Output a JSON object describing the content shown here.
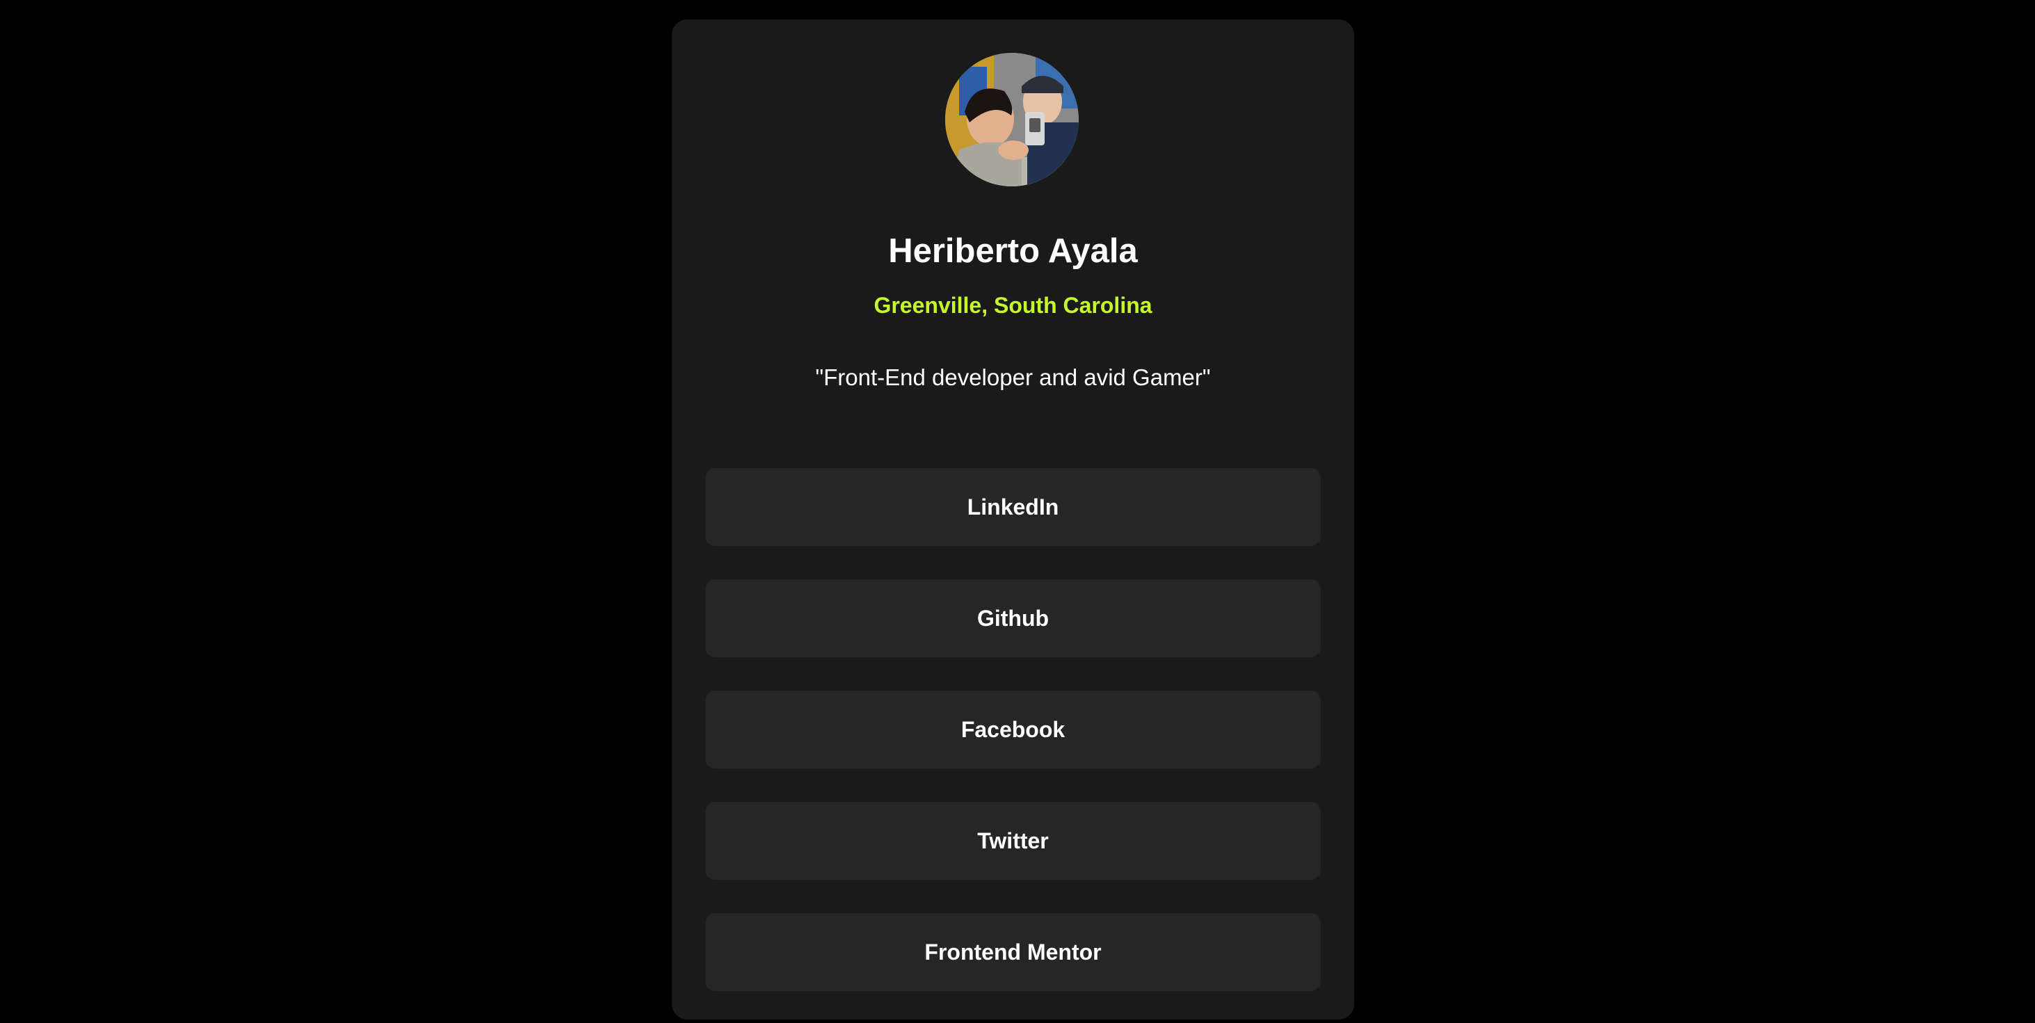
{
  "profile": {
    "name": "Heriberto Ayala",
    "location": "Greenville, South Carolina",
    "bio": "\"Front-End developer and avid Gamer\""
  },
  "links": [
    {
      "label": "LinkedIn"
    },
    {
      "label": "Github"
    },
    {
      "label": "Facebook"
    },
    {
      "label": "Twitter"
    },
    {
      "label": "Frontend Mentor"
    }
  ],
  "colors": {
    "background": "#000000",
    "card": "#1a1a1b",
    "button": "#262627",
    "accent": "#c4f82a",
    "text": "#ffffff"
  }
}
